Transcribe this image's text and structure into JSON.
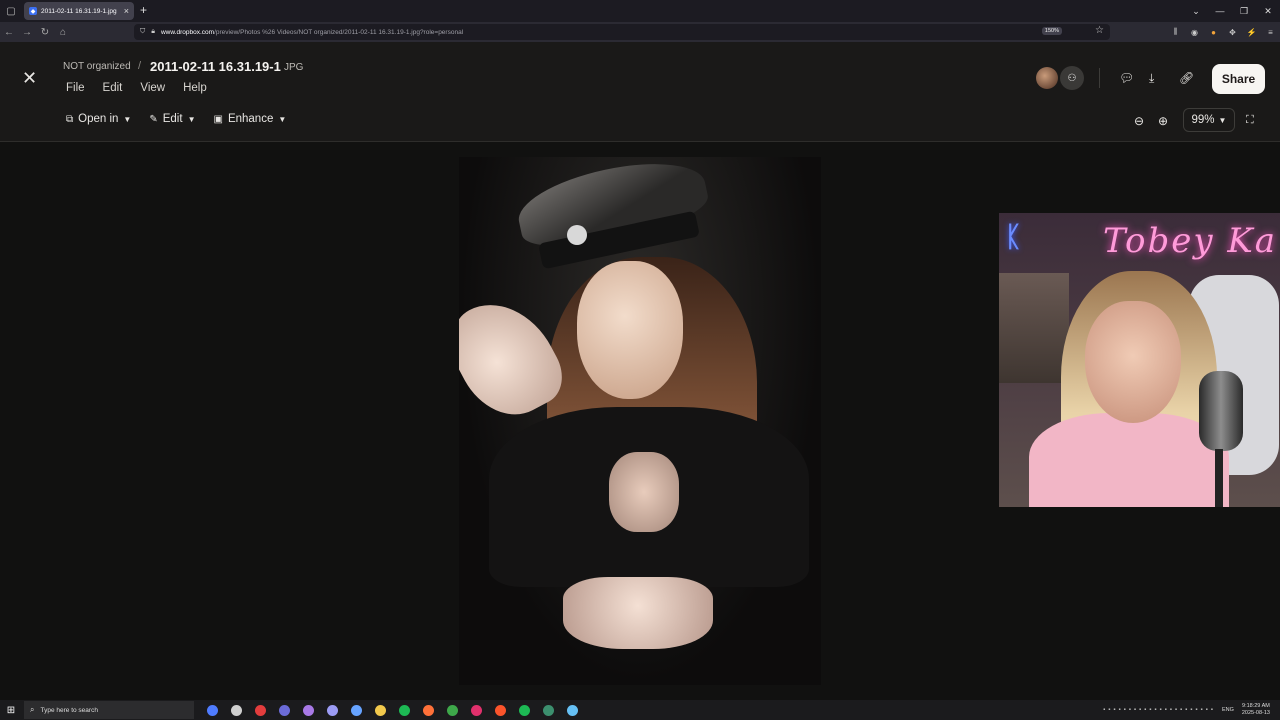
{
  "browser": {
    "tab_title": "2011-02-11 16.31.19-1.jpg",
    "url_domain": "www.dropbox.com",
    "url_path": "/preview/Photos %26 Videos/NOT organized/2011-02-11 16.31.19-1.jpg?role=personal",
    "zoom_badge": "150%"
  },
  "header": {
    "breadcrumb": "NOT organized",
    "separator": "/",
    "file_name": "2011-02-11 16.31.19-1",
    "file_type": "JPG",
    "menu": [
      "File",
      "Edit",
      "View",
      "Help"
    ],
    "share_label": "Share"
  },
  "toolbar": {
    "open_in": "Open in",
    "edit": "Edit",
    "enhance": "Enhance",
    "zoom_level": "99%"
  },
  "webcam": {
    "neon_sign": "Tobey Ka"
  },
  "taskbar": {
    "search_placeholder": "Type here to search",
    "language": "ENG",
    "time": "9:18:29 AM",
    "date": "2025-08-13"
  },
  "colors": {
    "app_bg": "#111110",
    "header_bg": "#1a1918",
    "share_bg": "#f7f5f2",
    "browser_chrome": "#2b2a33"
  }
}
